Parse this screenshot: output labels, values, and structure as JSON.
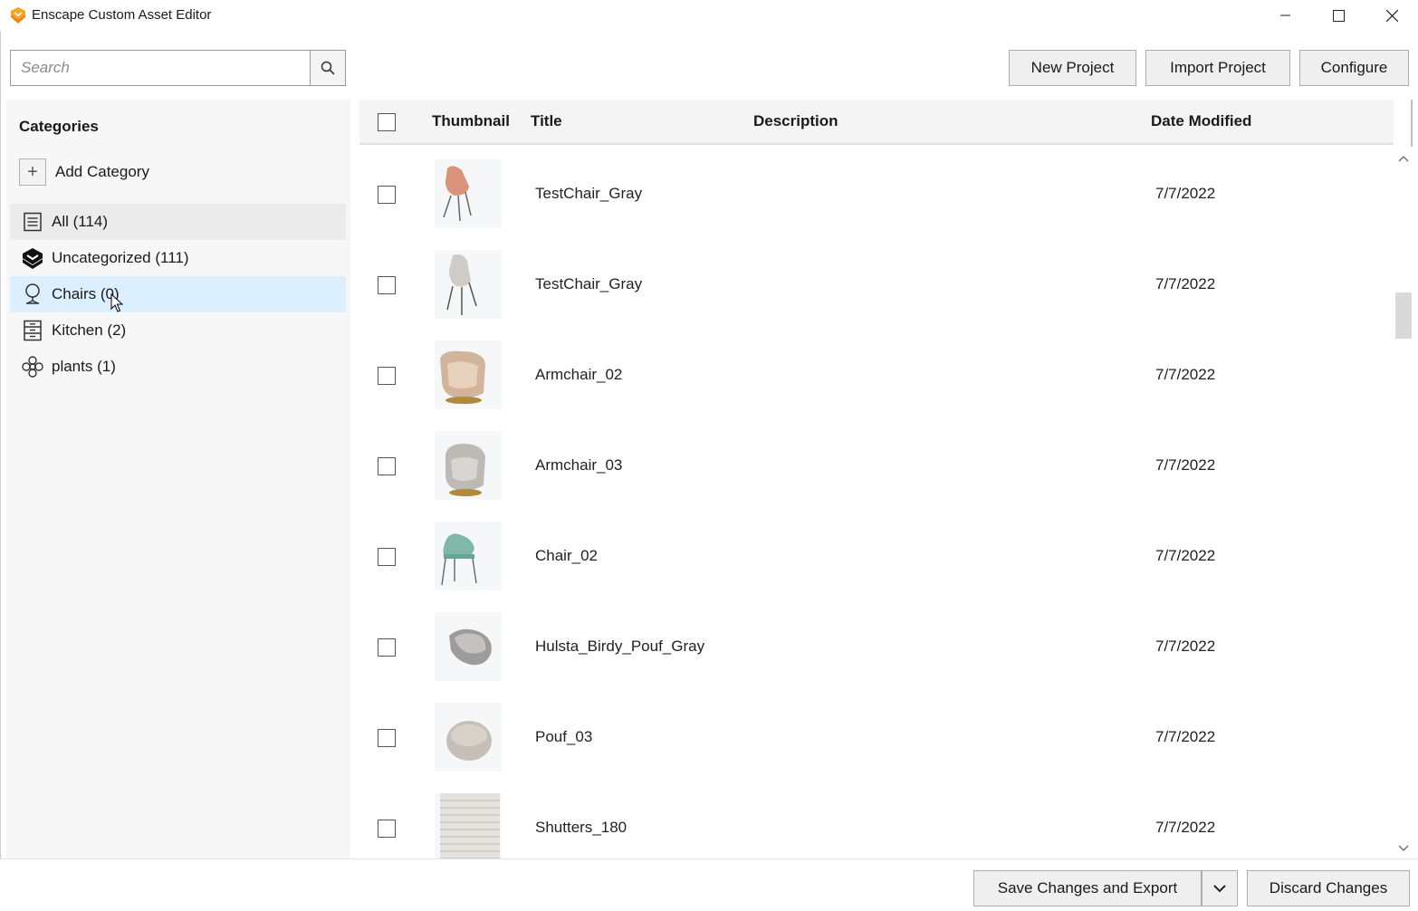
{
  "window": {
    "title": "Enscape Custom Asset Editor",
    "accent_color": "#f39c12"
  },
  "toolbar": {
    "search_placeholder": "Search",
    "new_project_label": "New Project",
    "import_project_label": "Import Project",
    "configure_label": "Configure"
  },
  "sidebar": {
    "title": "Categories",
    "add_category_label": "Add Category",
    "items": [
      {
        "label": "All (114)",
        "icon": "list-icon",
        "state": "hover"
      },
      {
        "label": "Uncategorized (111)",
        "icon": "enscape-logo-icon",
        "state": "normal"
      },
      {
        "label": "Chairs (0)",
        "icon": "chair-icon",
        "state": "selected"
      },
      {
        "label": "Kitchen (2)",
        "icon": "kitchen-icon",
        "state": "normal"
      },
      {
        "label": "plants (1)",
        "icon": "flower-icon",
        "state": "normal"
      }
    ]
  },
  "table": {
    "headers": {
      "thumbnail": "Thumbnail",
      "title": "Title",
      "description": "Description",
      "date_modified": "Date Modified"
    },
    "rows": [
      {
        "title": "TestChair_Gray",
        "description": "",
        "date": "7/7/2022",
        "thumb": "chair-pink"
      },
      {
        "title": "TestChair_Gray",
        "description": "",
        "date": "7/7/2022",
        "thumb": "chair-gray"
      },
      {
        "title": "Armchair_02",
        "description": "",
        "date": "7/7/2022",
        "thumb": "armchair-beige"
      },
      {
        "title": "Armchair_03",
        "description": "",
        "date": "7/7/2022",
        "thumb": "armchair-gray"
      },
      {
        "title": "Chair_02",
        "description": "",
        "date": "7/7/2022",
        "thumb": "chair-teal"
      },
      {
        "title": "Hulsta_Birdy_Pouf_Gray",
        "description": "",
        "date": "7/7/2022",
        "thumb": "pouf-gray"
      },
      {
        "title": "Pouf_03",
        "description": "",
        "date": "7/7/2022",
        "thumb": "pouf-beige"
      },
      {
        "title": "Shutters_180",
        "description": "",
        "date": "7/7/2022",
        "thumb": "shutters"
      }
    ]
  },
  "footer": {
    "save_label": "Save Changes and Export",
    "discard_label": "Discard Changes"
  }
}
